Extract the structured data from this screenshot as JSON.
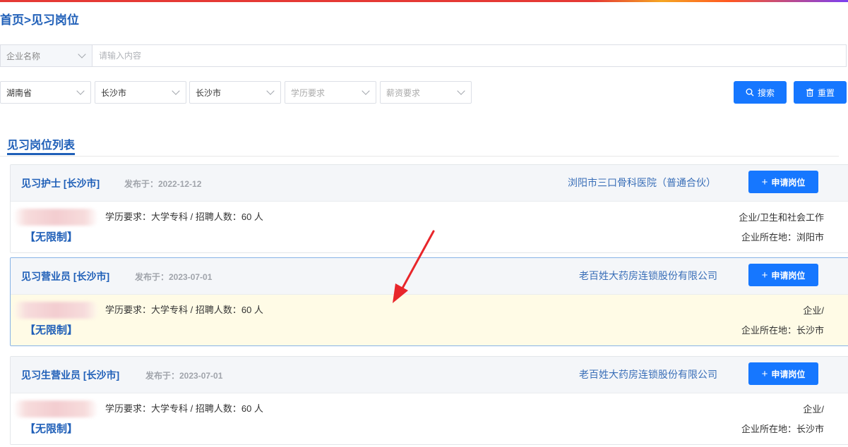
{
  "breadcrumb": {
    "home": "首页",
    "separator": ">",
    "current": "见习岗位"
  },
  "search": {
    "company_select": "企业名称",
    "keyword_placeholder": "请输入内容",
    "keyword_value": ""
  },
  "filters": {
    "province": "湖南省",
    "city": "长沙市",
    "district": "长沙市",
    "education_placeholder": "学历要求",
    "salary_placeholder": "薪资要求"
  },
  "buttons": {
    "search": "搜索",
    "reset": "重置"
  },
  "section_title": "见习岗位列表",
  "jobs": [
    {
      "title": "见习护士 [长沙市]",
      "date_label": "发布于：2022-12-12",
      "company": "浏阳市三口骨科医院（普通合伙）",
      "apply": "申请岗位",
      "requirements": "学历要求：大学专科 / 招聘人数：60 人",
      "salary_tag": "【无限制】",
      "industry": "企业/卫生和社会工作",
      "location": "企业所在地：浏阳市"
    },
    {
      "title": "见习营业员 [长沙市]",
      "date_label": "发布于：2023-07-01",
      "company": "老百姓大药房连锁股份有限公司",
      "apply": "申请岗位",
      "requirements": "学历要求：大学专科 / 招聘人数：60 人",
      "salary_tag": "【无限制】",
      "industry": "企业/",
      "location": "企业所在地：长沙市"
    },
    {
      "title": "见习生营业员 [长沙市]",
      "date_label": "发布于：2023-07-01",
      "company": "老百姓大药房连锁股份有限公司",
      "apply": "申请岗位",
      "requirements": "学历要求：大学专科 / 招聘人数：60 人",
      "salary_tag": "【无限制】",
      "industry": "企业/",
      "location": "企业所在地：长沙市"
    }
  ],
  "colors": {
    "primary": "#1677ff",
    "link": "#1f5fb8",
    "highlight_bg": "#fffbe6",
    "annotation_arrow": "#e8262b"
  }
}
